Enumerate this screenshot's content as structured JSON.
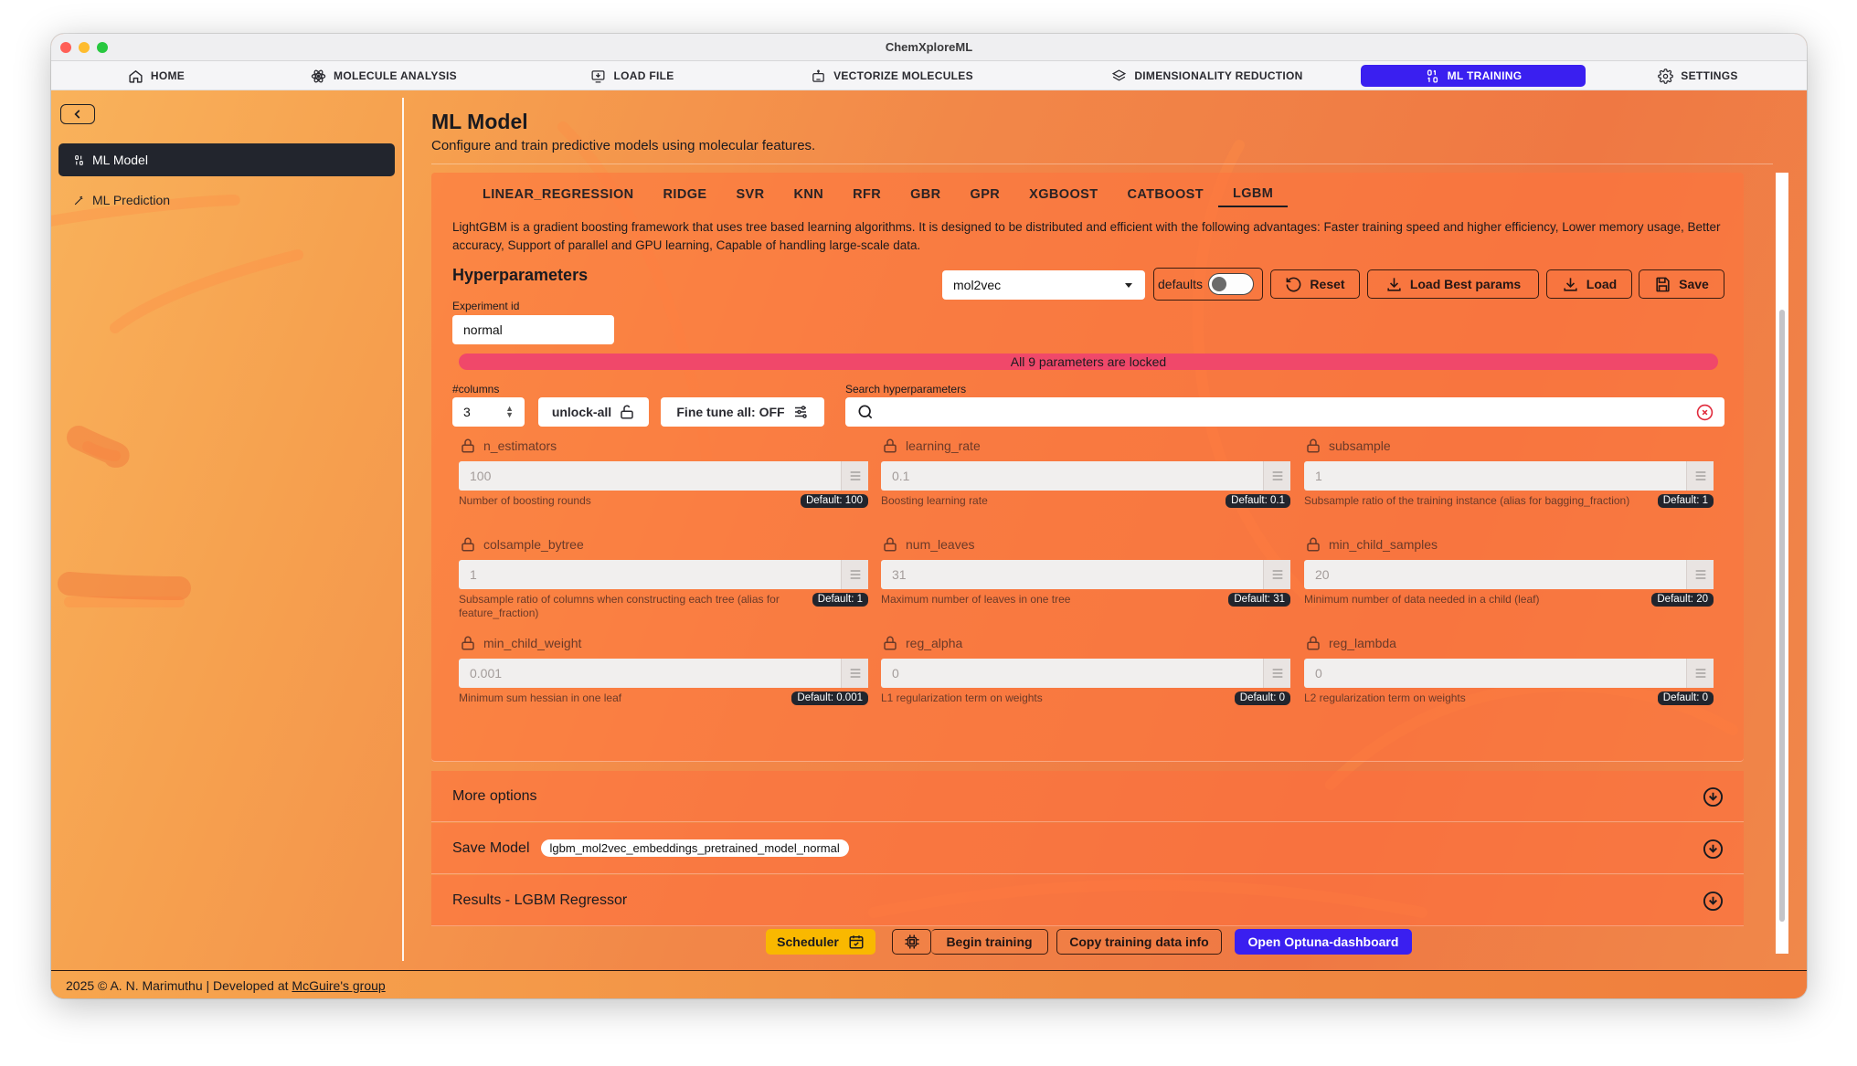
{
  "app": {
    "title": "ChemXploreML"
  },
  "nav": {
    "items": [
      {
        "label": "HOME",
        "icon": "home-icon"
      },
      {
        "label": "MOLECULE ANALYSIS",
        "icon": "atom-icon"
      },
      {
        "label": "LOAD FILE",
        "icon": "load-file-icon"
      },
      {
        "label": "VECTORIZE MOLECULES",
        "icon": "robot-icon"
      },
      {
        "label": "DIMENSIONALITY REDUCTION",
        "icon": "layers-icon"
      },
      {
        "label": "ML TRAINING",
        "icon": "binary-icon"
      },
      {
        "label": "SETTINGS",
        "icon": "gear-icon"
      }
    ],
    "active": "ML TRAINING"
  },
  "sidebar": {
    "items": [
      {
        "label": "ML Model",
        "icon": "binary-icon"
      },
      {
        "label": "ML Prediction",
        "icon": "wand-icon"
      }
    ]
  },
  "page": {
    "title": "ML Model",
    "subtitle": "Configure and train predictive models using molecular features."
  },
  "tabs": [
    "LINEAR_REGRESSION",
    "RIDGE",
    "SVR",
    "KNN",
    "RFR",
    "GBR",
    "GPR",
    "XGBOOST",
    "CATBOOST",
    "LGBM"
  ],
  "active_tab": "LGBM",
  "model": {
    "description": "LightGBM is a gradient boosting framework that uses tree based learning algorithms. It is designed to be distributed and efficient with the following advantages: Faster training speed and higher efficiency, Lower memory usage, Better accuracy, Support of parallel and GPU learning, Capable of handling large-scale data."
  },
  "hyper": {
    "title": "Hyperparameters",
    "embedding_select": "mol2vec",
    "defaults_label": "defaults",
    "defaults_on": false,
    "reset_label": "Reset",
    "load_best_label": "Load Best params",
    "load_label": "Load",
    "save_label": "Save",
    "experiment_label": "Experiment id",
    "experiment_value": "normal",
    "locked_message": "All 9 parameters are locked",
    "columns_label": "#columns",
    "columns_value": "3",
    "unlock_label": "unlock-all",
    "finetune_label": "Fine tune all: OFF",
    "search_label": "Search hyperparameters",
    "search_value": ""
  },
  "params": [
    {
      "name": "n_estimators",
      "value": "100",
      "help": "Number of boosting rounds",
      "default": "Default: 100"
    },
    {
      "name": "learning_rate",
      "value": "0.1",
      "help": "Boosting learning rate",
      "default": "Default: 0.1"
    },
    {
      "name": "subsample",
      "value": "1",
      "help": "Subsample ratio of the training instance (alias for bagging_fraction)",
      "default": "Default: 1"
    },
    {
      "name": "colsample_bytree",
      "value": "1",
      "help": "Subsample ratio of columns when constructing each tree (alias for feature_fraction)",
      "default": "Default: 1"
    },
    {
      "name": "num_leaves",
      "value": "31",
      "help": "Maximum number of leaves in one tree",
      "default": "Default: 31"
    },
    {
      "name": "min_child_samples",
      "value": "20",
      "help": "Minimum number of data needed in a child (leaf)",
      "default": "Default: 20"
    },
    {
      "name": "min_child_weight",
      "value": "0.001",
      "help": "Minimum sum hessian in one leaf",
      "default": "Default: 0.001"
    },
    {
      "name": "reg_alpha",
      "value": "0",
      "help": "L1 regularization term on weights",
      "default": "Default: 0"
    },
    {
      "name": "reg_lambda",
      "value": "0",
      "help": "L2 regularization term on weights",
      "default": "Default: 0"
    }
  ],
  "accordions": {
    "more_options": "More options",
    "save_model": "Save Model",
    "save_model_filename": "lgbm_mol2vec_embeddings_pretrained_model_normal",
    "results": "Results - LGBM Regressor"
  },
  "actions": {
    "scheduler": "Scheduler",
    "begin_training": "Begin training",
    "copy_info": "Copy training data info",
    "optuna": "Open Optuna-dashboard"
  },
  "footer": {
    "text": "2025 © A. N. Marimuthu | Developed at ",
    "link": "McGuire's group"
  },
  "colors": {
    "accent": "#3a1ff0",
    "locked_bar": "#f0486a",
    "scheduler": "#f9b800",
    "dark": "#22252d"
  }
}
